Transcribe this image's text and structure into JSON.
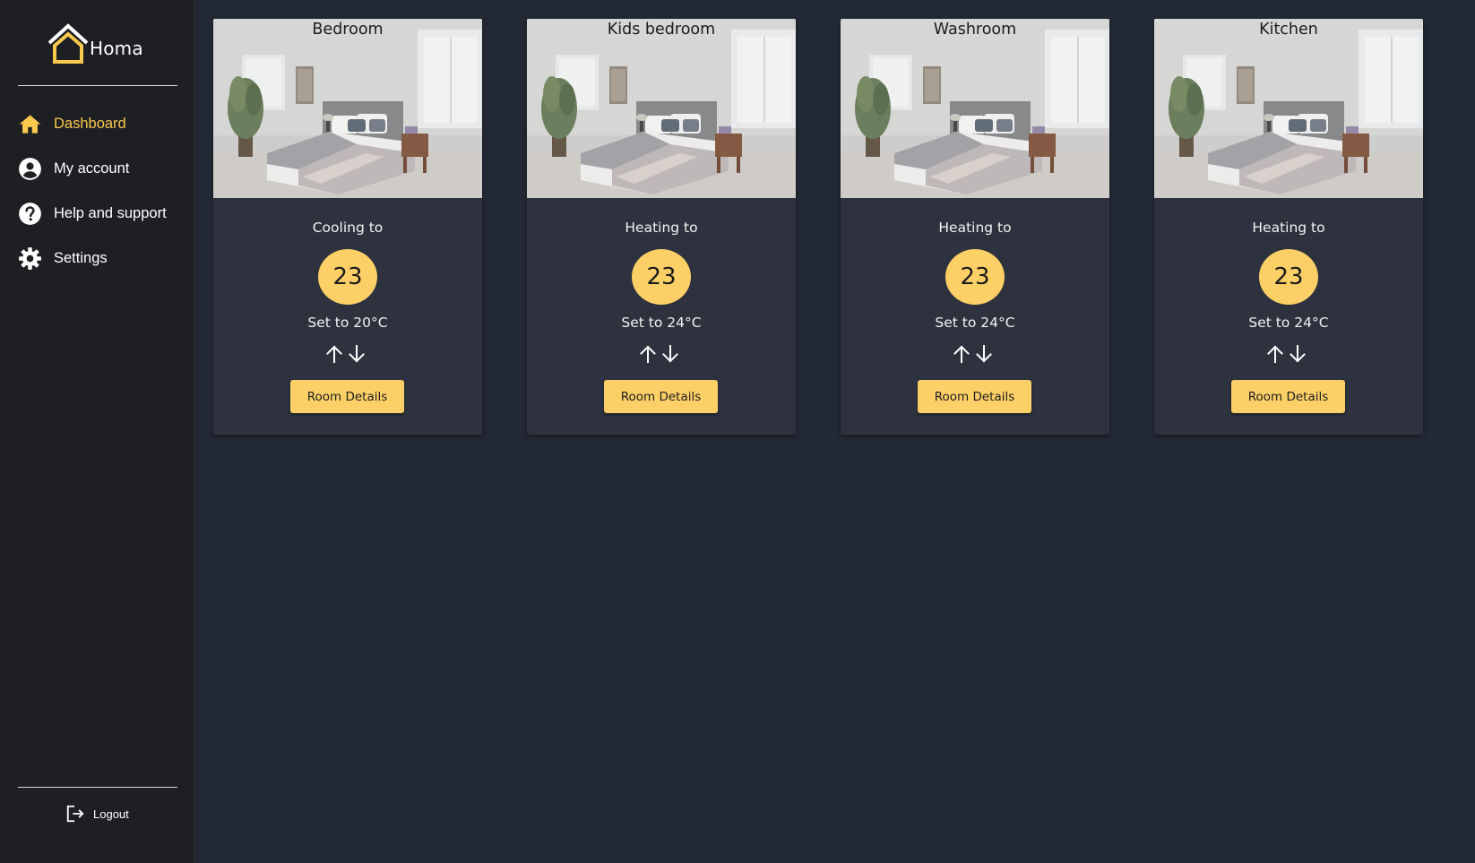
{
  "app": {
    "brand_name": "Homa"
  },
  "colors": {
    "accent": "#fcd066",
    "sidebar_bg": "#1d1f23",
    "page_bg": "#222834",
    "card_bg": "#2d323e"
  },
  "sidebar": {
    "items": [
      {
        "label": "Dashboard",
        "icon": "home-icon",
        "active": true
      },
      {
        "label": "My account",
        "icon": "account-circle-icon",
        "active": false
      },
      {
        "label": "Help and support",
        "icon": "help-circle-icon",
        "active": false
      },
      {
        "label": "Settings",
        "icon": "gear-icon",
        "active": false
      }
    ],
    "logout_label": "Logout"
  },
  "rooms": [
    {
      "name": "Bedroom",
      "mode": "Cooling to",
      "current": "23",
      "setpoint": "Set to 20°C",
      "button": "Room Details"
    },
    {
      "name": "Kids bedroom",
      "mode": "Heating to",
      "current": "23",
      "setpoint": "Set to 24°C",
      "button": "Room Details"
    },
    {
      "name": "Washroom",
      "mode": "Heating to",
      "current": "23",
      "setpoint": "Set to 24°C",
      "button": "Room Details"
    },
    {
      "name": "Kitchen",
      "mode": "Heating to",
      "current": "23",
      "setpoint": "Set to 24°C",
      "button": "Room Details"
    }
  ]
}
